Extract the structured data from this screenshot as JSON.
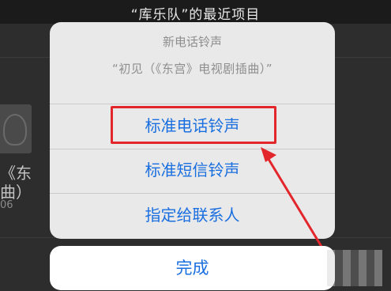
{
  "header": {
    "title": "“库乐队”的最近项目"
  },
  "background": {
    "item_title_line1": "《东",
    "item_title_line2": "曲）",
    "item_meta": "06"
  },
  "action_sheet": {
    "title": "新电话铃声",
    "subtitle": "“初见（《东宫》电视剧插曲）”",
    "options": [
      {
        "label": "标准电话铃声"
      },
      {
        "label": "标准短信铃声"
      },
      {
        "label": "指定给联系人"
      }
    ],
    "done_label": "完成"
  },
  "colors": {
    "accent": "#1a6fe0",
    "annotation": "#e3262b"
  },
  "icons": {
    "album_art": "music-note-icon",
    "watermark": "mosaic-watermark"
  }
}
